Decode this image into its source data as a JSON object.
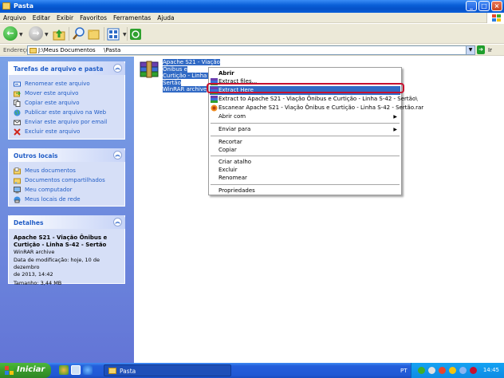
{
  "window": {
    "title": "Pasta"
  },
  "menubar": [
    "Arquivo",
    "Editar",
    "Exibir",
    "Favoritos",
    "Ferramentas",
    "Ajuda"
  ],
  "address": {
    "label": "Endereço",
    "path": "J:\\Meus Documentos",
    "path_tail": "\\Pasta",
    "go_label": "Ir"
  },
  "tasks_panel": {
    "title": "Tarefas de arquivo e pasta",
    "items": [
      {
        "label": "Renomear este arquivo",
        "icon": "rename-icon"
      },
      {
        "label": "Mover este arquivo",
        "icon": "move-icon"
      },
      {
        "label": "Copiar este arquivo",
        "icon": "copy-icon"
      },
      {
        "label": "Publicar este arquivo na Web",
        "icon": "globe-icon"
      },
      {
        "label": "Enviar este arquivo por email",
        "icon": "email-icon"
      },
      {
        "label": "Excluir este arquivo",
        "icon": "delete-icon"
      }
    ]
  },
  "places_panel": {
    "title": "Outros locais",
    "items": [
      {
        "label": "Meus documentos",
        "icon": "documents-folder-icon"
      },
      {
        "label": "Documentos compartilhados",
        "icon": "shared-folder-icon"
      },
      {
        "label": "Meu computador",
        "icon": "computer-icon"
      },
      {
        "label": "Meus locais de rede",
        "icon": "network-icon"
      }
    ]
  },
  "details_panel": {
    "title": "Detalhes",
    "file_title_1": "Apache S21 - Viação Ônibus e",
    "file_title_2": "Curtição - Linha S-42 - Sertão",
    "type": "WinRAR archive",
    "modified_1": "Data de modificação: hoje, 10 de dezembro",
    "modified_2": "de 2013, 14:42",
    "size": "Tamanho: 3,44 MB"
  },
  "file": {
    "name_1": "Apache S21 - Viação Ônibus e",
    "name_2": "Curtição - Linha S-42 - Sertão",
    "type": "WinRAR archive"
  },
  "context_menu": {
    "open": "Abrir",
    "extract_files": "Extract files...",
    "extract_here": "Extract Here",
    "extract_to": "Extract to Apache S21 - Viação Ônibus e Curtição - Linha S-42 - Sertão\\",
    "scan": "Escanear Apache S21 - Viação Ônibus e Curtição - Linha S-42 - Sertão.rar",
    "open_with": "Abrir com",
    "send_to": "Enviar para",
    "cut": "Recortar",
    "copy": "Copiar",
    "create_shortcut": "Criar atalho",
    "delete": "Excluir",
    "rename": "Renomear",
    "properties": "Propriedades"
  },
  "taskbar": {
    "start": "Iniciar",
    "task": "Pasta",
    "lang": "PT",
    "clock": "14:45"
  }
}
